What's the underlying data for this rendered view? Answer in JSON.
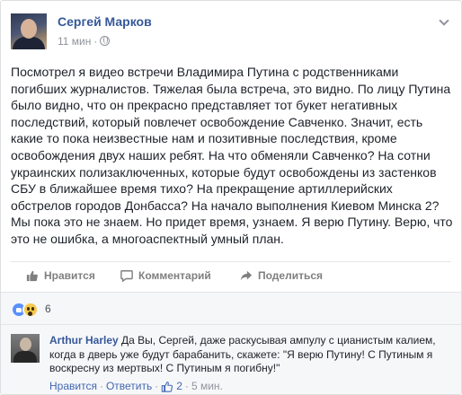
{
  "post": {
    "author": "Сергей Марков",
    "time": "11 мин",
    "separator": "·",
    "text": "Посмотрел я видео встречи Владимира Путина с родственниками погибших журналистов. Тяжелая была встреча, это видно. По лицу Путина было видно, что он прекрасно представляет тот букет негативных последствий, который повлечет освобождение Савченко. Значит, есть какие то пока неизвестные нам и позитивные последствия, кроме освобождения двух наших ребят. На что обменяли Савченко? На сотни украинских полизаключенных, которые будут освобождены из застенков СБУ в ближайшее время тихо? На прекращение артиллерийских обстрелов городов Донбасса? На начало выполнения Киевом Минска 2? Мы пока это не знаем. Но придет время, узнаем. Я верю Путину. Верю, что это не ошибка, а многоаспектный умный план."
  },
  "actions": {
    "like": "Нравится",
    "comment": "Комментарий",
    "share": "Поделиться"
  },
  "reactions": {
    "count": "6",
    "icons": [
      "like-icon",
      "wow-icon"
    ],
    "like_color": "#5890ff",
    "wow_color": "#f7c94a"
  },
  "comment": {
    "author": "Arthur Harley",
    "text": "Да Вы, Сергей, даже раскусывая ампулу с цианистым калием, когда в дверь уже будут барабанить, скажете: \"Я верю Путину! С Путиным я воскресну из мертвых! С Путиным я погибну!\"",
    "like": "Нравится",
    "reply": "Ответить",
    "likes": "2",
    "time": "5 мин.",
    "dot": "·"
  },
  "colors": {
    "link": "#365899",
    "meta": "#90949c",
    "border": "#dddfe2"
  }
}
